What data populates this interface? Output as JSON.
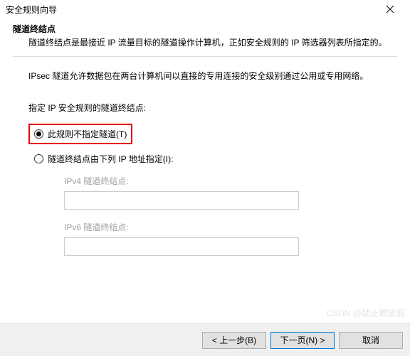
{
  "window": {
    "title": "安全规则向导"
  },
  "page": {
    "heading": "隧道终结点",
    "subheading": "隧道终结点是最接近 IP 流量目标的隧道操作计算机，正如安全规则的 IP 筛选器列表所指定的。",
    "description": "IPsec 隧道允许数据包在两台计算机间以直接的专用连接的安全级别通过公用或专用网络。",
    "prompt": "指定 IP 安全规则的隧道终结点:"
  },
  "options": {
    "no_tunnel": "此规则不指定隧道(T)",
    "specify_ip": "隧道终结点由下列 IP 地址指定(I):"
  },
  "fields": {
    "ipv4_label": "IPv4 隧道终结点:",
    "ipv4_value": "",
    "ipv6_label": "IPv6 隧道终结点:",
    "ipv6_value": ""
  },
  "buttons": {
    "back": "< 上一步(B)",
    "next": "下一页(N) >",
    "cancel": "取消"
  },
  "watermark": "CSDN @禁止燃放烟"
}
